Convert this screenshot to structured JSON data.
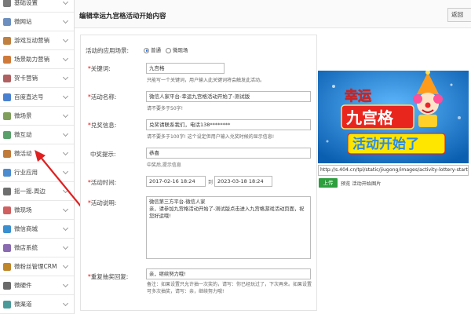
{
  "sidebar": {
    "items": [
      {
        "label": "基础设置",
        "icon": "settings-icon"
      },
      {
        "label": "微网站",
        "icon": "home-icon"
      },
      {
        "label": "游戏互动营销",
        "icon": "gamepad-icon"
      },
      {
        "label": "场景助力营销",
        "icon": "scene-icon"
      },
      {
        "label": "贺卡营销",
        "icon": "card-icon"
      },
      {
        "label": "百度直达号",
        "icon": "baidu-icon"
      },
      {
        "label": "微场景",
        "icon": "scene-screen-icon"
      },
      {
        "label": "微互动",
        "icon": "interaction-icon"
      },
      {
        "label": "微活动",
        "icon": "activity-icon"
      },
      {
        "label": "行业应用",
        "icon": "industry-icon"
      },
      {
        "label": "摇一摇.周边",
        "icon": "shake-icon"
      },
      {
        "label": "微现场",
        "icon": "live-icon"
      },
      {
        "label": "微信商城",
        "icon": "shop-icon"
      },
      {
        "label": "微店系统",
        "icon": "store-icon"
      },
      {
        "label": "微粉丝管理CRM",
        "icon": "crm-icon"
      },
      {
        "label": "微硬件",
        "icon": "hardware-icon"
      },
      {
        "label": "微渠道",
        "icon": "channel-icon"
      }
    ]
  },
  "header": {
    "title": "编辑幸运九宫格活动开始内容",
    "back_label": "返回"
  },
  "form": {
    "scene_label": "活动的应用场景:",
    "scene_options": [
      "普通",
      "微现场"
    ],
    "keyword_label": "关键词:",
    "keyword_value": "九宫格",
    "keyword_hint_red": "只能写一个关键词",
    "keyword_hint": "，用户输入此关键词将会触发此活动。",
    "name_label": "活动名称:",
    "name_value": "微信人家平台-幸运九宫格活动开始了-测试版",
    "name_hint": "请不要多于50字!",
    "prize_info_label": "兑奖信息:",
    "prize_info_value": "兑奖请联系我们，电话138********",
    "prize_info_hint": "请不要多于100字! 这个设定但用户输入兑奖时候的显示信息!",
    "win_tip_label": "中奖提示:",
    "win_tip_value": "恭喜",
    "win_tip_hint": "中奖后,提示信息",
    "time_label": "活动时间:",
    "start_time": "2017-02-16 18:24",
    "time_sep": "到",
    "end_time": "2023-03-18 18:24",
    "desc_label": "活动说明:",
    "desc_value": "微信第三方平台-微信人家\n亲，请参加九宫格活动开始了-测试版点击进入九宫格游戏活动页面，祝您好运哦!",
    "repeat_label": "重复抽奖回复:",
    "repeat_value": "亲，继续努力哦!",
    "repeat_hint": "备注：如果设置只允许抽一次奖的，请写：你已经玩过了，下次再来。如果设置可多次抽奖，请写：亲，继续努力哦!"
  },
  "preview": {
    "banner_top": "幸运",
    "banner_mid": "九宫格",
    "banner_bottom": "活动开始了",
    "url": "http://s.404.cn/tpl/static/jiugong/images/activity-lottery-start.jpg",
    "upload_label": "上传",
    "preview_label": "预览 活动开始图片"
  },
  "colors": {
    "accent_green": "#2e9e3e",
    "required_red": "#e00000",
    "preview_bg": "#1a7fd0"
  }
}
